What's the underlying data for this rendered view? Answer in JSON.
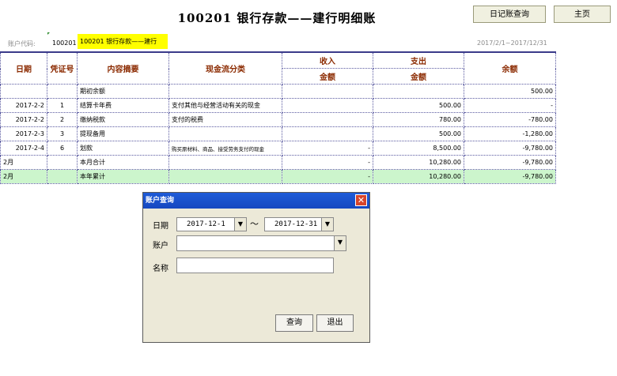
{
  "page": {
    "title": "100201 银行存款——建行明细账",
    "buttons": {
      "query": "日记账查询",
      "home": "主页"
    },
    "account_label": "账户代码:",
    "account_code": "100201",
    "account_name": "100201 银行存款——建行",
    "date_range": "2017/2/1~2017/12/31"
  },
  "table": {
    "headers": {
      "date": "日期",
      "voucher": "凭证号",
      "summary": "内容摘要",
      "cashflow": "现金流分类",
      "income": "收入",
      "expense": "支出",
      "balance": "余额",
      "amount": "金额"
    },
    "rows": [
      {
        "date": "",
        "voucher": "",
        "summary": "期初余额",
        "cashflow": "",
        "income": "",
        "expense": "",
        "balance": "500.00"
      },
      {
        "date": "2017-2-2",
        "voucher": "1",
        "summary": "结算卡年费",
        "cashflow": "支付其他与经营活动有关的现金",
        "income": "",
        "expense": "500.00",
        "balance": "-"
      },
      {
        "date": "2017-2-2",
        "voucher": "2",
        "summary": "缴纳税款",
        "cashflow": "支付的税费",
        "income": "",
        "expense": "780.00",
        "balance": "-780.00"
      },
      {
        "date": "2017-2-3",
        "voucher": "3",
        "summary": "提现备用",
        "cashflow": "",
        "income": "",
        "expense": "500.00",
        "balance": "-1,280.00"
      },
      {
        "date": "2017-2-4",
        "voucher": "6",
        "summary": "划款",
        "cashflow": "购买原材料、商品、接受劳务支付的现金",
        "income": "-",
        "expense": "8,500.00",
        "balance": "-9,780.00"
      },
      {
        "date": "2月",
        "voucher": "",
        "summary": "本月合计",
        "cashflow": "",
        "income": "-",
        "expense": "10,280.00",
        "balance": "-9,780.00"
      },
      {
        "date": "2月",
        "voucher": "",
        "summary": "本年累计",
        "cashflow": "",
        "income": "-",
        "expense": "10,280.00",
        "balance": "-9,780.00"
      }
    ]
  },
  "dialog": {
    "title": "账户查询",
    "close": "✕",
    "date_label": "日期",
    "date_from": "2017-12-1",
    "tilde": "～",
    "date_to": "2017-12-31",
    "account_label": "账户",
    "account_value": "",
    "name_label": "名称",
    "name_value": "",
    "query_button": "查询",
    "exit_button": "退出"
  },
  "icons": {
    "dropdown": "dropdown-arrow-icon"
  }
}
